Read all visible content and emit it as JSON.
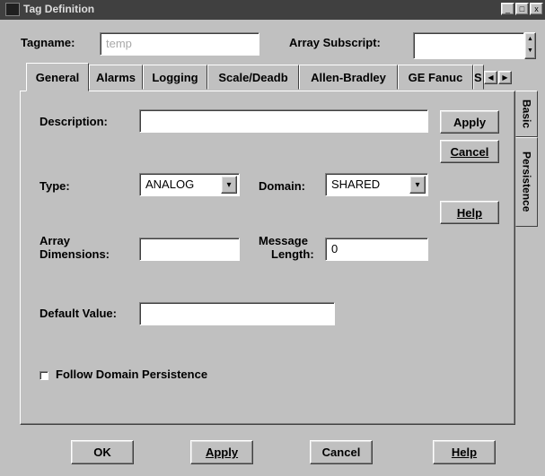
{
  "window": {
    "title": "Tag Definition",
    "minimize_glyph": "_",
    "maximize_glyph": "□",
    "close_glyph": "x"
  },
  "header": {
    "tagname_label": "Tagname:",
    "tagname_value": "temp",
    "array_subscript_label": "Array Subscript:",
    "array_subscript_value": ""
  },
  "tabs": [
    {
      "label": "General",
      "active": true
    },
    {
      "label": "Alarms"
    },
    {
      "label": "Logging"
    },
    {
      "label": "Scale/Deadb"
    },
    {
      "label": "Allen-Bradley"
    },
    {
      "label": "GE Fanuc"
    },
    {
      "label": "S"
    }
  ],
  "side_tabs": [
    {
      "label": "Basic"
    },
    {
      "label": "Persistence"
    }
  ],
  "general": {
    "description_label": "Description:",
    "description_value": "",
    "type_label": "Type:",
    "type_value": "ANALOG",
    "domain_label": "Domain:",
    "domain_value": "SHARED",
    "array_dimensions_label_1": "Array",
    "array_dimensions_label_2": "Dimensions:",
    "array_dimensions_value": "",
    "message_length_label_1": "Message",
    "message_length_label_2": "Length:",
    "message_length_value": "0",
    "default_value_label": "Default Value:",
    "default_value_value": "",
    "follow_domain_label": "Follow Domain Persistence",
    "follow_domain_checked": false
  },
  "panel_buttons": {
    "apply": "Apply",
    "cancel": "Cancel",
    "help": "Help"
  },
  "bottom_buttons": {
    "ok": "OK",
    "apply": "Apply",
    "cancel": "Cancel",
    "help": "Help"
  },
  "icons": {
    "combo_arrow": "down-arrow-icon",
    "spinner": "spinner-arrows-icon",
    "tab_scroll_left": "left-arrow-icon",
    "tab_scroll_right": "right-arrow-icon"
  }
}
